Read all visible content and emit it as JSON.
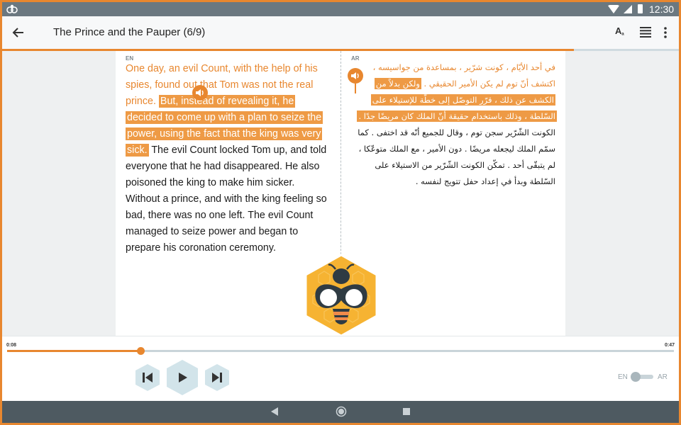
{
  "status_bar": {
    "time": "12:30"
  },
  "app_bar": {
    "title": "The Prince and the Pauper (6/9)",
    "font_size_label": "A"
  },
  "reading_progress": 0.845,
  "reader": {
    "left_language": "EN",
    "right_language": "AR",
    "en": {
      "read": "One day, an evil Count, with the help of his spies, found out that Tom was not the real prince.",
      "current": "But, instead of revealing it, he decided to come up with a plan to seize the power, using the fact that the king was very sick.",
      "upcoming": "The evil Count locked Tom up, and told everyone that he had disappeared. He also poisoned the king to make him sicker.    Without a prince, and with the king feeling so bad, there was no one left.    The evil Count managed to seize power and began to prepare his coronation ceremony."
    },
    "ar": {
      "read": "في أحد الأيّام ، كونت شرّير ، بمساعدة من جواسيسه ، اكتشف أنّ توم لم يكن الأمير الحقيقي .",
      "current": "ولكن بدلاً من الكشف عن ذلك ، قرّر التوصّل إلى خطّة للإستيلاء على السّلطة ، وذلك باستخدام حقيقة أنّ الملك كان مريضًا جدًا .",
      "upcoming": "الكونت الشّرّير سجن توم ، وقال للجميع أنّه قد اختفى .  كما سمّم الملك ليجعله مريضًا .   دون الأمير ، مع الملك متوعّكا ، لم يتبقّى أحد .   تمكّن الكونت الشّرّير من الاستيلاء على السّلطة وبدأ في إعداد حفل تتويج لنفسه ."
    }
  },
  "player": {
    "elapsed": "0:08",
    "total": "0:47",
    "progress": 0.2,
    "toggle_left": "EN",
    "toggle_right": "AR"
  },
  "icons": {
    "back": "arrow-back-icon",
    "font_size": "font-size-icon",
    "text_lines": "text-lines-icon",
    "more": "more-vert-icon",
    "speaker": "speaker-icon",
    "prev": "skip-previous-icon",
    "play": "play-icon",
    "next": "skip-next-icon",
    "logo": "bee-logo-icon"
  },
  "colors": {
    "accent": "#e8872f",
    "highlight": "#ee9a45",
    "frame": "#e8872f"
  }
}
